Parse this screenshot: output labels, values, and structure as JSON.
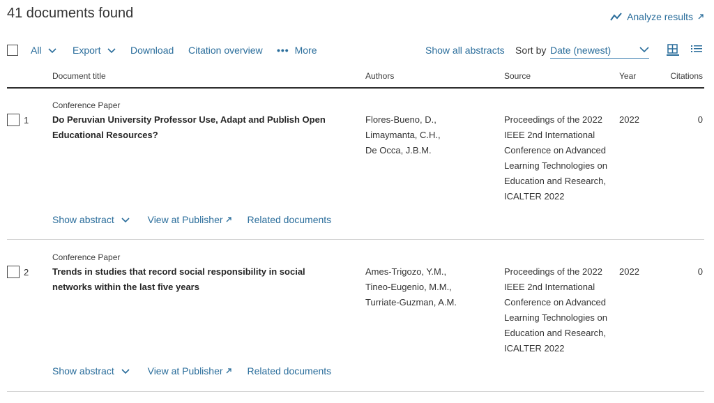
{
  "header": {
    "results_title": "41 documents found",
    "analyze_label": "Analyze results"
  },
  "toolbar": {
    "all_label": "All",
    "export_label": "Export",
    "download_label": "Download",
    "citation_overview_label": "Citation overview",
    "more_label": "More",
    "show_all_abstracts_label": "Show all abstracts",
    "sort_by_label": "Sort by",
    "sort_value": "Date (newest)"
  },
  "columns": {
    "title": "Document title",
    "authors": "Authors",
    "source": "Source",
    "year": "Year",
    "citations": "Citations"
  },
  "actions": {
    "show_abstract": "Show abstract",
    "view_at_publisher": "View at Publisher",
    "related_documents": "Related documents"
  },
  "results": [
    {
      "index": "1",
      "type": "Conference Paper",
      "title": "Do Peruvian University Professor Use, Adapt and Publish Open Educational Resources?",
      "authors": [
        "Flores-Bueno, D.,",
        "Limaymanta, C.H.,",
        "De Occa, J.B.M."
      ],
      "source": "Proceedings of the 2022 IEEE 2nd International Conference on Advanced Learning Technologies on Education and Research, ICALTER 2022",
      "year": "2022",
      "citations": "0"
    },
    {
      "index": "2",
      "type": "Conference Paper",
      "title": "Trends in studies that record social responsibility in social networks within the last five years",
      "authors": [
        "Ames-Trigozo, Y.M.,",
        "Tineo-Eugenio, M.M.,",
        "Turriate-Guzman, A.M."
      ],
      "source": "Proceedings of the 2022 IEEE 2nd International Conference on Advanced Learning Technologies on Education and Research, ICALTER 2022",
      "year": "2022",
      "citations": "0"
    }
  ],
  "colors": {
    "link": "#2a6d9b",
    "text": "#2e2e2e",
    "rule": "#d6d6d6"
  }
}
